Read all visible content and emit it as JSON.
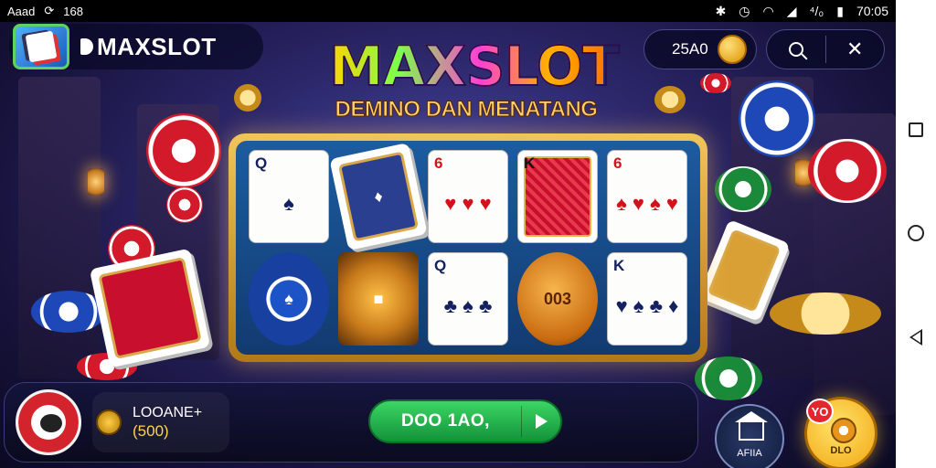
{
  "status_bar": {
    "left_text": "Aaad",
    "left_count": "168",
    "battery_text": "⁴/₀",
    "time": "70:05"
  },
  "brand": {
    "name": "MAXSLOT"
  },
  "title": {
    "main": "MAXSLOT",
    "sub": "DEMINO DAN MENATANG"
  },
  "balance": {
    "value": "25A0"
  },
  "reels": {
    "row1": [
      {
        "kind": "card",
        "rank": "Q",
        "color": "blk",
        "pips": "♠"
      },
      {
        "kind": "tile",
        "label": "♦"
      },
      {
        "kind": "card",
        "rank": "6",
        "color": "red",
        "pips": "♥ ♥ ♥"
      },
      {
        "kind": "redback",
        "rank": "K"
      },
      {
        "kind": "card",
        "rank": "6",
        "color": "red",
        "pips": "♠ ♥ ♠ ♥"
      }
    ],
    "row2": [
      {
        "kind": "chip",
        "label": "♠"
      },
      {
        "kind": "chest",
        "label": "■"
      },
      {
        "kind": "card",
        "rank": "Q",
        "color": "blk",
        "pips": "♣ ♠ ♣"
      },
      {
        "kind": "coin",
        "label": "003"
      },
      {
        "kind": "card",
        "rank": "K",
        "color": "blk",
        "pips": "♥ ♠ ♣ ♦"
      }
    ]
  },
  "player": {
    "name": "LOOANE+",
    "amount": "(500)"
  },
  "spin": {
    "label": "DOO 1AO,"
  },
  "home": {
    "label": "AFIIA"
  },
  "bonus": {
    "badge": "YO",
    "label": "DLO"
  },
  "colors": {
    "accent_green": "#1fb44c",
    "gold": "#f2c55a",
    "background": "#2b2668"
  },
  "icons": [
    "wifi-icon",
    "bluetooth-icon",
    "signal-icon",
    "battery-icon",
    "search-icon",
    "close-icon",
    "home-icon",
    "play-icon",
    "coin-icon"
  ]
}
